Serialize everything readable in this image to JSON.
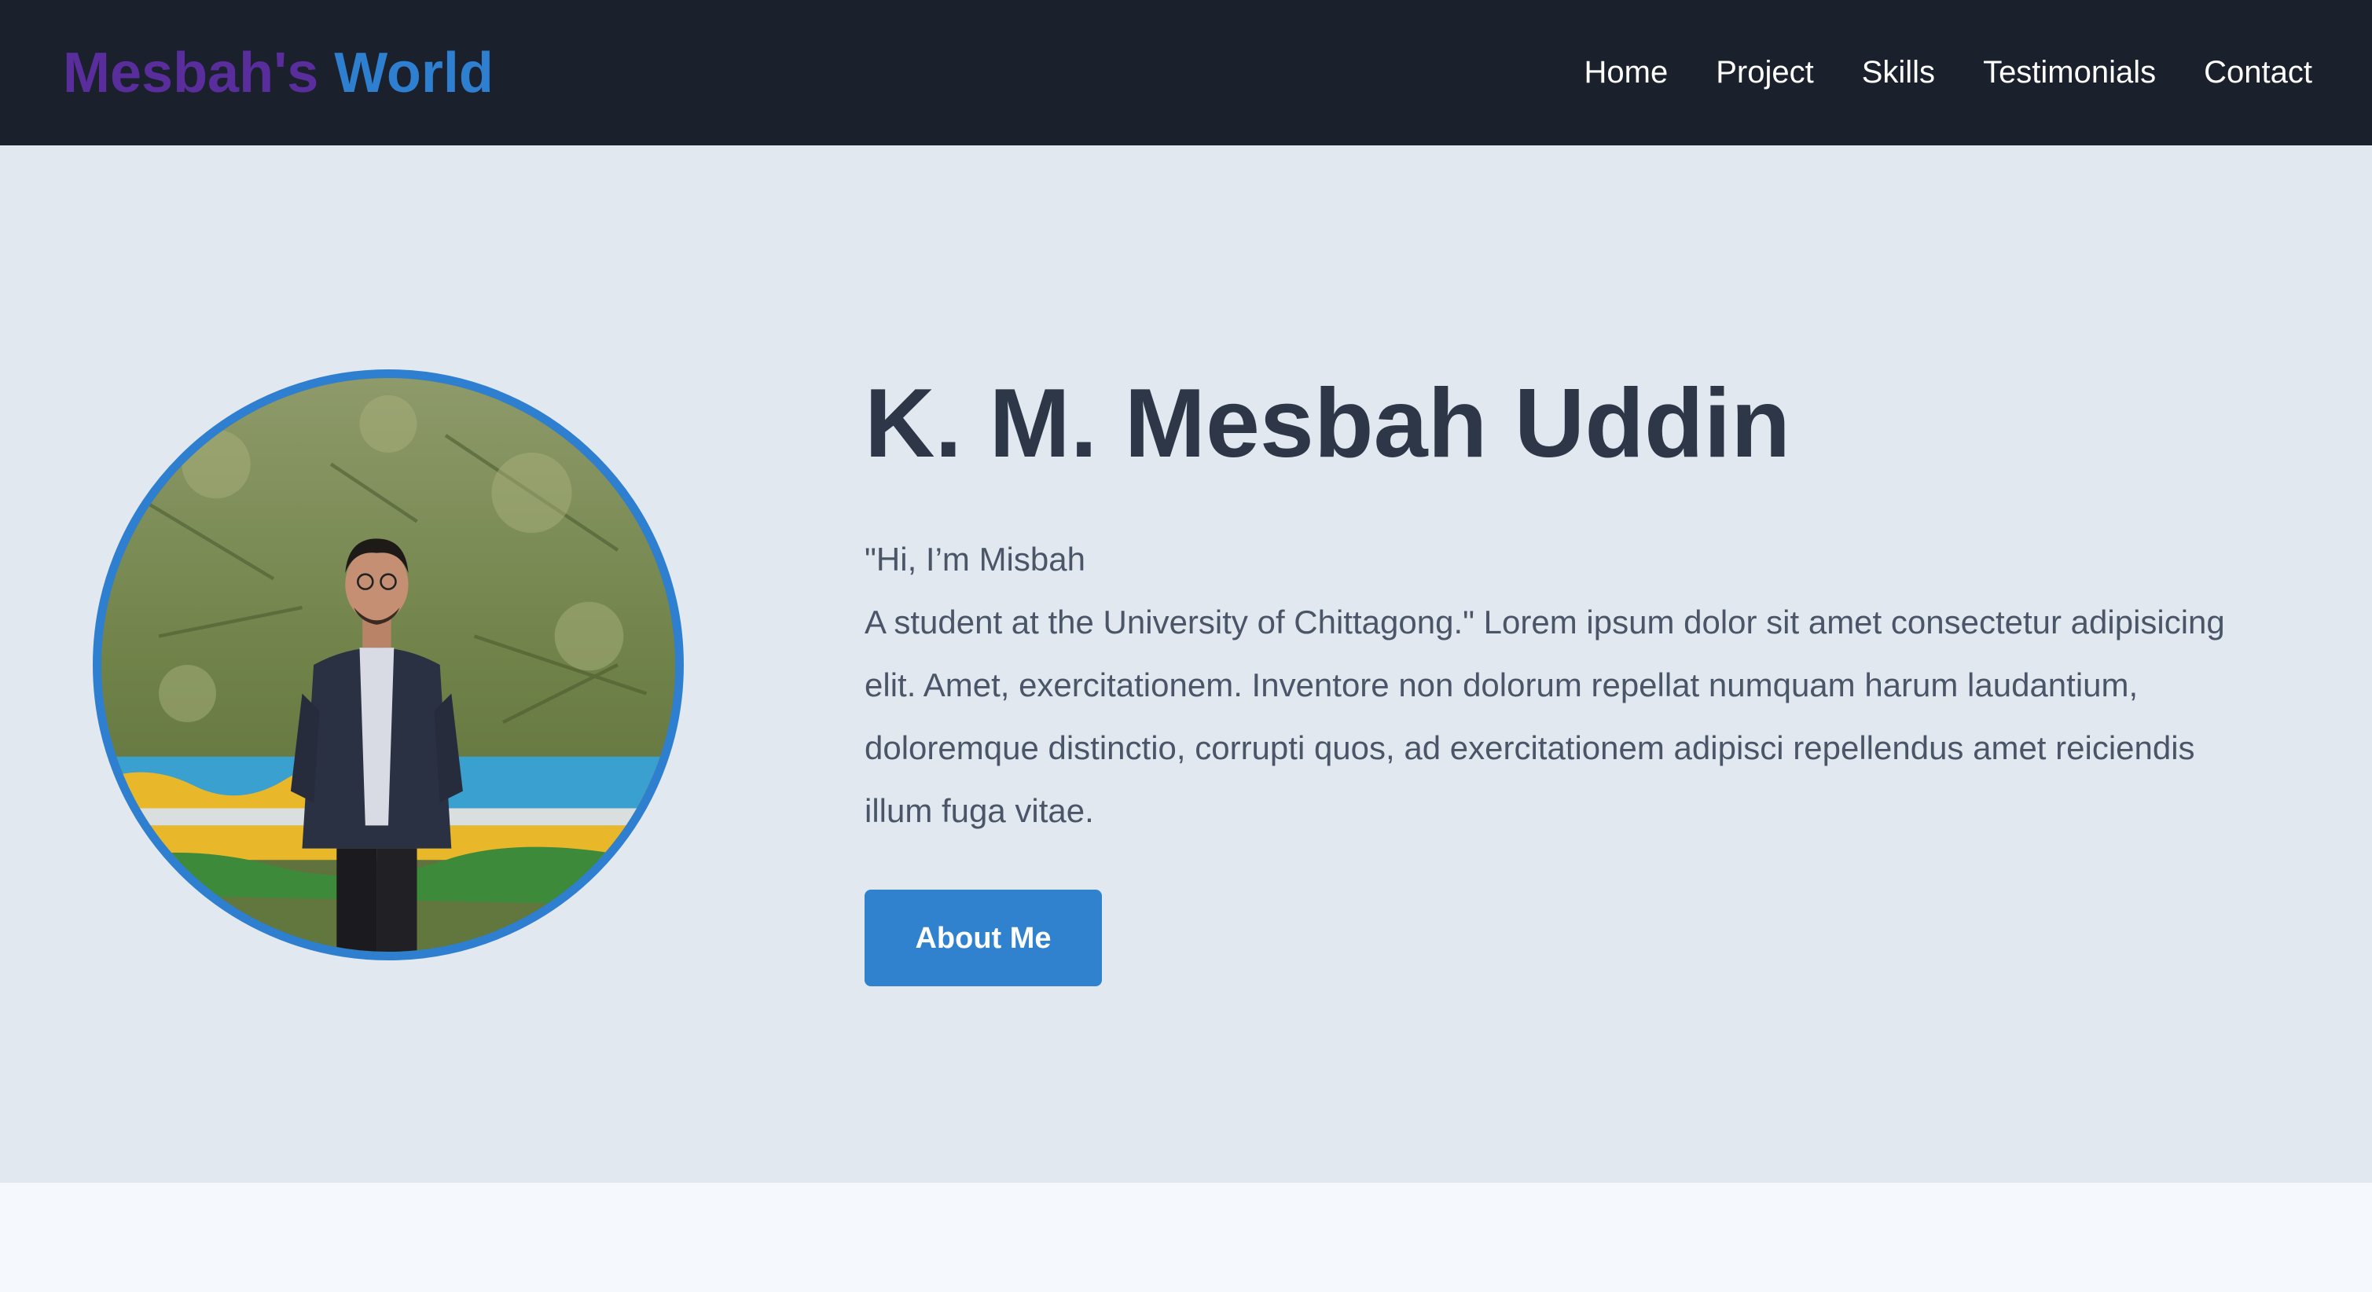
{
  "header": {
    "logo_first": "Mesbah's",
    "logo_second": "World",
    "nav": [
      {
        "label": "Home"
      },
      {
        "label": "Project"
      },
      {
        "label": "Skills"
      },
      {
        "label": "Testimonials"
      },
      {
        "label": "Contact"
      }
    ]
  },
  "hero": {
    "name": "K. M. Mesbah Uddin",
    "greeting": "\"Hi, I’m Misbah",
    "description": "A student at the University of Chittagong.\" Lorem ipsum dolor sit amet consectetur adipisicing elit. Amet, exercitationem. Inventore non dolorum repellat numquam harum laudantium, doloremque distinctio, corrupti quos, ad exercitationem adipisci repellendus amet reiciendis illum fuga vitae.",
    "button_label": "About Me"
  },
  "colors": {
    "navbar_bg": "#1a202c",
    "logo_purple": "#5a2d9c",
    "logo_blue": "#2f7fd1",
    "hero_bg": "#e2e8f0",
    "heading": "#2d3748",
    "body_text": "#4a5568",
    "accent": "#3182ce"
  }
}
